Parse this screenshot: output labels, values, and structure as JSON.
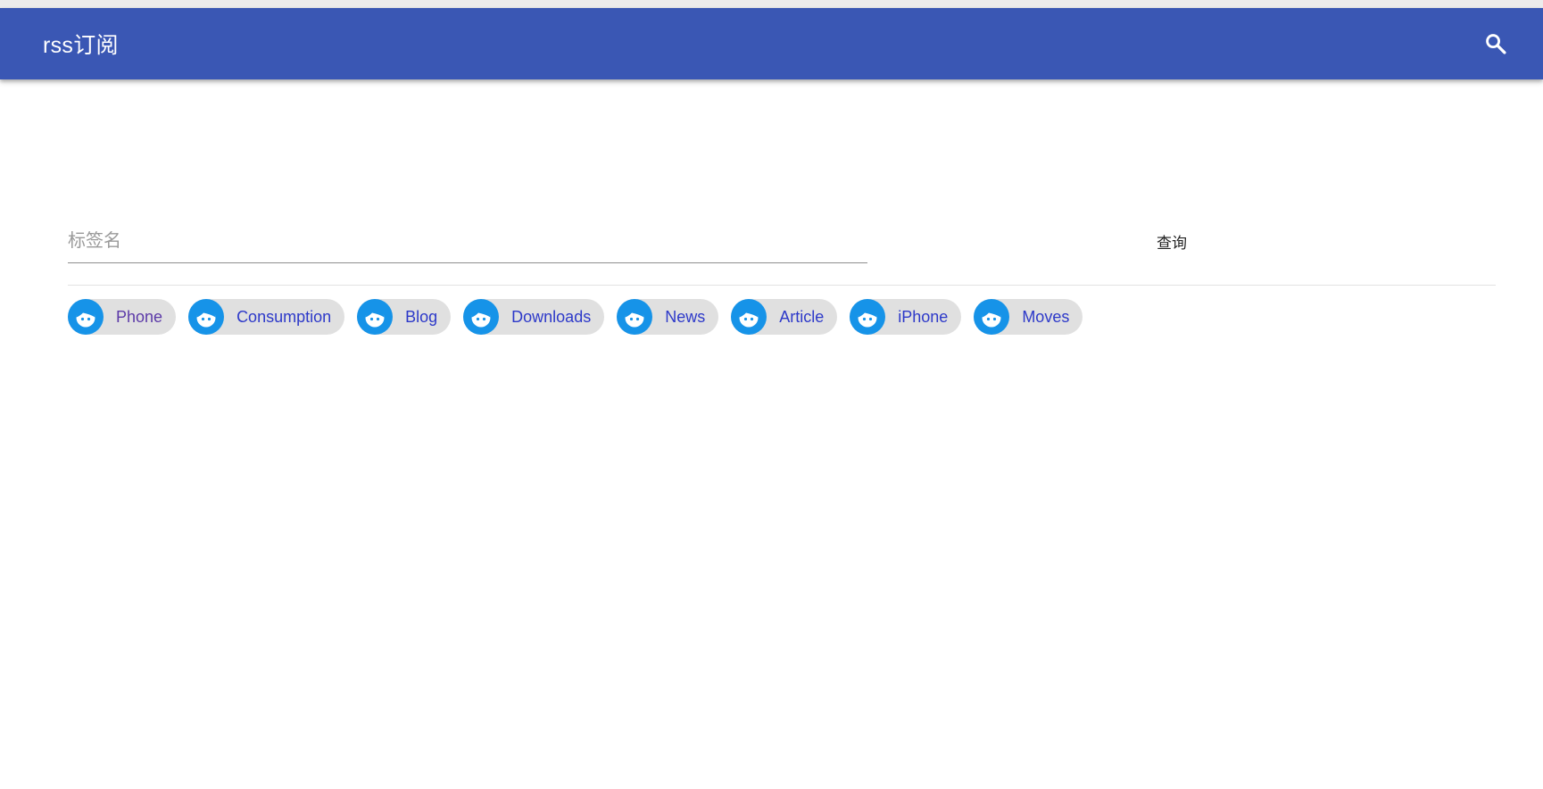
{
  "header": {
    "title": "rss订阅",
    "search_icon": "search-icon",
    "bar_color": "#3a57b4"
  },
  "search": {
    "placeholder": "标签名",
    "value": "",
    "button_label": "查询"
  },
  "tags": {
    "avatar_icon": "face-icon",
    "avatar_color": "#1693e8",
    "label_color": "#2d39c9",
    "items": [
      {
        "label": "Phone"
      },
      {
        "label": "Consumption"
      },
      {
        "label": "Blog"
      },
      {
        "label": "Downloads"
      },
      {
        "label": "News"
      },
      {
        "label": "Article"
      },
      {
        "label": "iPhone"
      },
      {
        "label": "Moves"
      }
    ]
  }
}
